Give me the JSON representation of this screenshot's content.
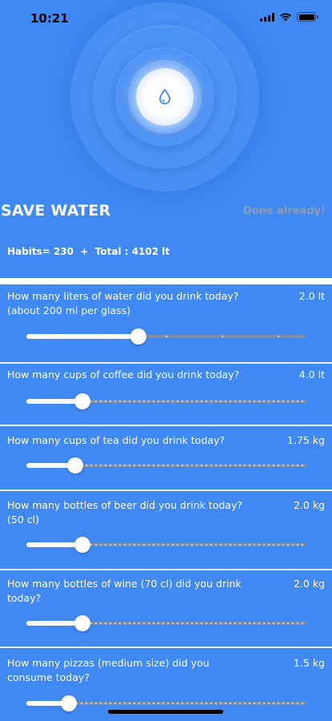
{
  "status_bar": {
    "time": "10:21"
  },
  "app": {
    "title": "SAVE WATER",
    "done_label": "Done already!",
    "summary": "Habits= 230  +  Total : 4102 lt"
  },
  "questions": [
    {
      "text": "How many liters of water did you drink today? (about 200 ml per glass)",
      "value": "2.0 lt",
      "level": 0.4,
      "ticks": "sparse"
    },
    {
      "text": "How many cups of coffee did you drink today?",
      "value": "4.0 lt",
      "level": 0.2,
      "ticks": "dense"
    },
    {
      "text": "How many cups of tea did you drink today?",
      "value": "1.75 kg",
      "level": 0.175,
      "ticks": "dense"
    },
    {
      "text": "How many bottles of beer did you drink today? (50 cl)",
      "value": "2.0 kg",
      "level": 0.2,
      "ticks": "dense"
    },
    {
      "text": "How many bottles of wine (70 cl) did you drink today?",
      "value": "2.0 kg",
      "level": 0.2,
      "ticks": "dense"
    },
    {
      "text": "How many pizzas (medium size) did you consume today?",
      "value": "1.5 kg",
      "level": 0.15,
      "ticks": "dense"
    }
  ],
  "icons": {
    "hero": "water-drop-icon",
    "signal": "cellular-signal-icon",
    "wifi": "wifi-icon",
    "battery": "battery-icon"
  },
  "colors": {
    "background": "#4088F2",
    "accent": "#ffffff",
    "done_link": "#8c9bb3",
    "track": "#7e8ea8"
  }
}
